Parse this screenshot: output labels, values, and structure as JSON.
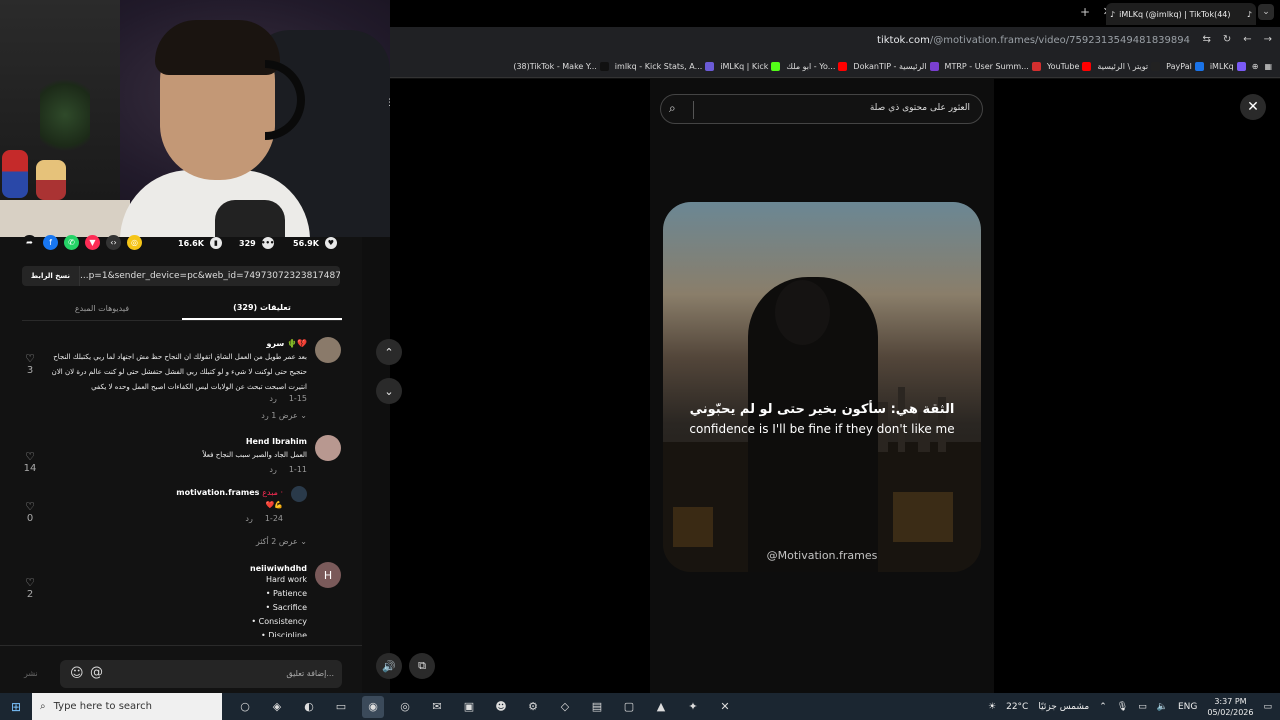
{
  "browser": {
    "tab_title": "iMLKq (@imlkq) | TikTok(44)",
    "url_domain": "tiktok.com",
    "url_path": "/@motivation.frames/video/7592313549481839894",
    "bookmarks": [
      {
        "label": "(38)TikTok - Make Y...",
        "color": "#111111"
      },
      {
        "label": "imlkq - Kick Stats, A...",
        "color": "#6b5bd6"
      },
      {
        "label": "iMLKq | Kick",
        "color": "#53fc18"
      },
      {
        "label": "ابو ملك - Yo...",
        "color": "#ff0000"
      },
      {
        "label": "DokanTIP - الرئيسية",
        "color": "#7a3fd1"
      },
      {
        "label": "MTRP - User Summ...",
        "color": "#d32f2f"
      },
      {
        "label": "YouTube",
        "color": "#ff0000"
      },
      {
        "label": "تويتر \\ الرئيسية",
        "color": "#222222"
      },
      {
        "label": "PayPal",
        "color": "#1a73e8"
      },
      {
        "label": "iMLKq",
        "color": "#7a5af5"
      }
    ]
  },
  "video_actions": {
    "likes": "56.9K",
    "comments": "329",
    "saves": "16.6K",
    "share_icons": [
      {
        "name": "coin-icon",
        "color": "#f5c518",
        "glyph": "◎"
      },
      {
        "name": "embed-icon",
        "color": "#333333",
        "glyph": "‹›"
      },
      {
        "name": "send-icon",
        "color": "#fe2c55",
        "glyph": "▼"
      },
      {
        "name": "whatsapp-icon",
        "color": "#25d366",
        "glyph": "✆"
      },
      {
        "name": "facebook-icon",
        "color": "#1877f2",
        "glyph": "f"
      },
      {
        "name": "share-arrow-icon",
        "color": "#121212",
        "glyph": "➦"
      }
    ]
  },
  "copy_link": {
    "button": "نسخ الرابط",
    "url": "...p=1&sender_device=pc&web_id=7497307232381748743"
  },
  "tabs": {
    "comments": "(329) تعليقات",
    "creator_videos": "فيديوهات المبدع"
  },
  "comments": [
    {
      "name": "سرو 🌵💔",
      "text": "بعد عمر طويل من العمل الشاق اتقولك ان النجاح حظ مش اجتهاد لما ربي يكتبلك النجاح حتجيح حتى لوكنت لا شيء و لو كتبلك ربي الفشل حتفشل حتى لو كنت عالم درة لان الان انتيرت اصبحت تبحث عن الولايات ليس الكفاءات اصبح العمل وحده لا يكفي",
      "date": "1-15",
      "reply": "رد",
      "likes": "3",
      "replies": "عرض 1 رد"
    },
    {
      "name": "Hend Ibrahim",
      "text": "العمل الجاد والصبر سبب النجاح فعلاً",
      "date": "1-11",
      "reply": "رد",
      "likes": "14"
    },
    {
      "name": "motivation.frames",
      "badge": "مبدع ·",
      "text": "💪❤️",
      "date": "1-24",
      "reply": "رد",
      "likes": "0",
      "replies": "عرض 2 أكثر"
    },
    {
      "name": "neiiwiwhdhd",
      "avatar": "H",
      "lines": [
        "Hard work",
        "• Patience",
        "• Sacrifice",
        "• Consistency",
        "• Discipline"
      ],
      "likes": "2"
    }
  ],
  "add_comment": {
    "placeholder": "إضافة تعليق...",
    "post": "نشر"
  },
  "search": {
    "placeholder": "العثور على محتوى ذي صلة"
  },
  "video": {
    "caption_ar": "الثقة هي: سأكون بخير حتى لو لم يحبّوني",
    "caption_en": "confidence is I'll be fine if they don't like me",
    "watermark": "@Motivation.frames"
  },
  "taskbar": {
    "search_placeholder": "Type here to search",
    "weather_temp": "22°C",
    "weather_text": "مشمس جزئيًا",
    "language": "ENG",
    "time": "3:37 PM",
    "date": "05/02/2026"
  }
}
